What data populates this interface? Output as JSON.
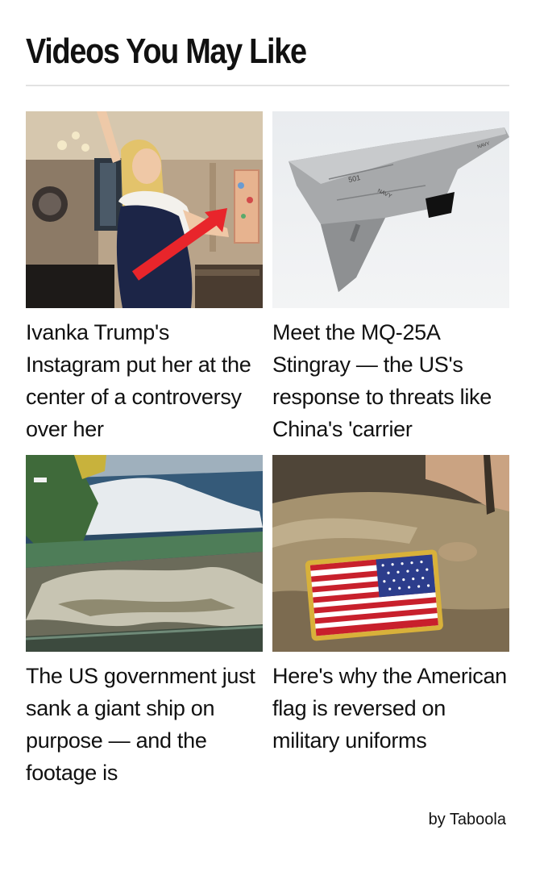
{
  "widget": {
    "title": "Videos You May Like",
    "attribution": "by Taboola"
  },
  "cards": [
    {
      "title": "Ivanka Trump's Instagram put her at the center of a controversy over her",
      "thumbnail": "woman in white and navy dress posing in apartment with red arrow pointing at painting"
    },
    {
      "title": "Meet the MQ-25A Stingray — the US's response to threats like China's 'carrier",
      "thumbnail": "grey tailless navy drone flying against pale sky"
    },
    {
      "title": "The US government just sank a giant ship on purpose — and the footage is",
      "thumbnail": "waves crashing over deck of sinking ship"
    },
    {
      "title": "Here's why the American flag is reversed on military uniforms",
      "thumbnail": "American flag patch on soldier's camouflage uniform sleeve"
    }
  ],
  "colors": {
    "divider": "#e2e2e2",
    "arrow": "#e8252b",
    "text": "#111111"
  }
}
